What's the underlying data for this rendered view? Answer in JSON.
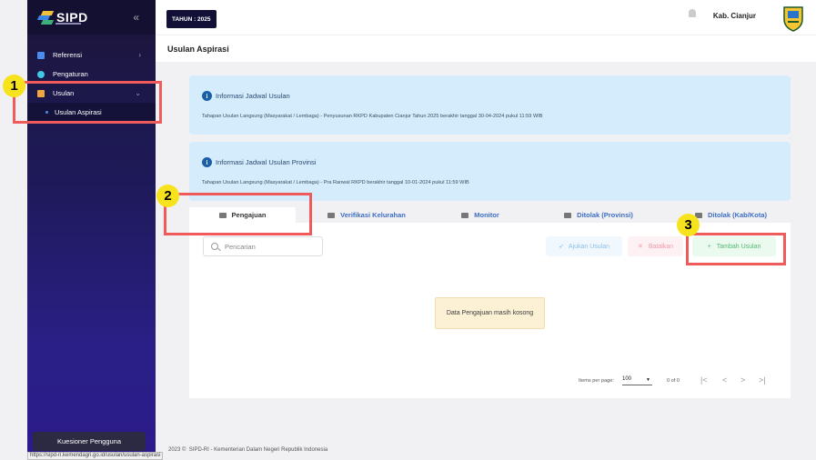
{
  "sidebar": {
    "logo": "SIPD",
    "collapse_icon": "«",
    "items": [
      {
        "label": "Referensi",
        "icon": "table-icon",
        "color": "#4a8cf0"
      },
      {
        "label": "Pengaturan",
        "icon": "gear-icon",
        "color": "#42c8e5"
      },
      {
        "label": "Usulan",
        "icon": "inbox-icon",
        "color": "#f2a640"
      }
    ],
    "sub_items": [
      {
        "label": "Usulan Aspirasi"
      }
    ],
    "kuesioner": "Kuesioner Pengguna"
  },
  "status_url": "https://sipd-ri.kemendagri.go.id/usulan/usulan-aspirasi",
  "topbar": {
    "tahun": "TAHUN : 2025",
    "region": "Kab. Cianjur"
  },
  "page": {
    "title": "Usulan Aspirasi"
  },
  "info_boxes": [
    {
      "title": "Informasi Jadwal Usulan",
      "desc": "Tahapan Usulan Langsung (Masyarakat / Lembaga) - Penyusunan RKPD Kabupaten Cianjur Tahun 2025 berakhir tanggal 30-04-2024 pukul 11:59 WIB"
    },
    {
      "title": "Informasi Jadwal Usulan Provinsi",
      "desc": "Tahapan Usulan Langsung (Masyarakat / Lembaga) - Pra Ranwal RKPD berakhir tanggal 10-01-2024 pukul 11:59 WIB"
    }
  ],
  "tabs": [
    {
      "label": "Pengajuan",
      "active": true
    },
    {
      "label": "Verifikasi Kelurahan"
    },
    {
      "label": "Monitor"
    },
    {
      "label": "Ditolak (Provinsi)"
    },
    {
      "label": "Ditolak (Kab/Kota)"
    }
  ],
  "search": {
    "placeholder": "Pencarian"
  },
  "actions": {
    "ajukan": "Ajukan Usulan",
    "batalkan": "Batalkan",
    "tambah": "Tambah Usulan"
  },
  "empty_message": "Data Pengajuan masih kosong",
  "pagination": {
    "items_per_page_label": "Items per page:",
    "items_per_page": "100",
    "range": "0 of 0",
    "first": "|<",
    "prev": "<",
    "next": ">",
    "last": ">|"
  },
  "annotations": [
    "1",
    "2",
    "3"
  ],
  "footer": {
    "year": "2023 ©",
    "text": "SIPD-RI - Kementerian Dalam Negeri Republik Indonesia"
  }
}
